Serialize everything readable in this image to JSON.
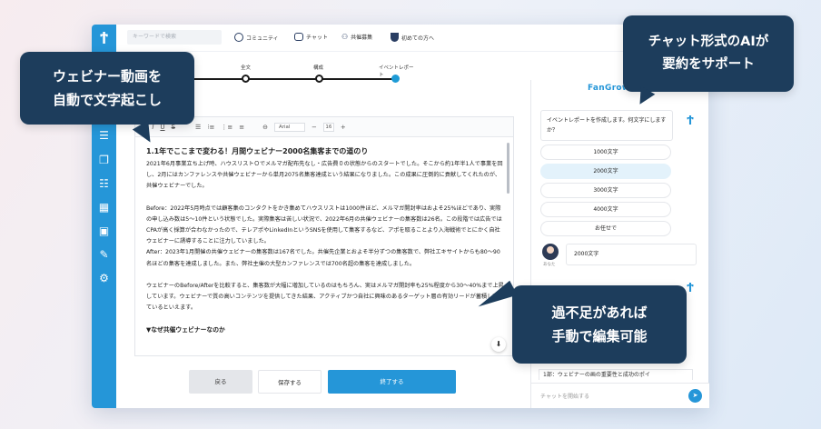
{
  "search": {
    "placeholder": "キーワードで検索"
  },
  "nav": {
    "items": [
      {
        "label": "コミュニティ",
        "icon": "globe-icon"
      },
      {
        "label": "チャット",
        "icon": "chat-bubble-icon"
      },
      {
        "label": "共催募集",
        "icon": "people-icon"
      },
      {
        "label": "初めての方へ",
        "icon": "shield-icon"
      }
    ]
  },
  "steps": {
    "items": [
      {
        "label": "全文",
        "active": false
      },
      {
        "label": "構成",
        "active": false
      },
      {
        "label": "イベントレポート",
        "active": true
      }
    ]
  },
  "toolbar": {
    "font": "Arial",
    "size": "16",
    "minus": "−",
    "plus": "+"
  },
  "editor": {
    "title": "1.1年でここまで変わる！月間ウェビナー2000名集客までの道のり",
    "paragraphs": [
      "2021年6月事業立ち上げ時、ハウスリストＯでメルマガ配布先なし・広告費０の状態からのスタートでした。そこから約1年半1人で事業を回し、2月にはカンファレンスや共催ウェビナーから単月2075名集客達成という結果になりました。この成果に圧倒的に貢献してくれたのが、共催ウェビナーでした。",
      "Before：2022年5月時点では顧客集のコンタクトをかき集めてハウスリストは1000件ほど、メルマガ開封率はおよそ25%ほどであり、実際の申し込み数は5〜10件という状態でした。実際集客は苦しい状況で、2022年6月の共催ウェビナーの集客数は26名。この段階では広告ではCPAが高く採算が合わなかったので、テレアポやLinkedInというSNSを使用して集客するなど、アポを取ることより入海戦術でとにかく自社ウェビナーに誘導することに注力していました。\nAfter：2023年1月開催の共催ウェビナーの集客数は167名でした。共催先企業とおよそ半分ずつの集客数で、弊社エキサイトからも80〜90名ほどの集客を達成しました。また、弊社主催の大型カンファレンスでは700名超の集客を達成しました。",
      "ウェビナーのBefore/Afterを比較すると、集客数が大幅に増加しているのはもちろん、実はメルマガ開封率も25%程度から30〜40%まで上昇しています。ウェビナーで質の高いコンテンツを提供してきた結果、アクティブかつ自社に興味のあるターゲット層の有効リードが蓄積してきているといえます。"
    ],
    "section_heading": "▼なぜ共催ウェビナーなのか"
  },
  "footer": {
    "back": "戻る",
    "save": "保存する",
    "finish": "終了する"
  },
  "chat": {
    "logo": "FanGrowth",
    "bot_message": "イベントレポートを作成します。何文字にしますか？",
    "options": [
      {
        "label": "1000文字",
        "selected": false
      },
      {
        "label": "2000文字",
        "selected": true
      },
      {
        "label": "3000文字",
        "selected": false
      },
      {
        "label": "4000文字",
        "selected": false
      },
      {
        "label": "お任せで",
        "selected": false
      }
    ],
    "user_reply": "2000文字",
    "user_name": "あなた",
    "preview": "1部：ウェビナーの画の重要性と成功のポイ",
    "input_placeholder": "チャットを開始する"
  },
  "callouts": {
    "left": [
      "ウェビナー動画を",
      "自動で文字起こし"
    ],
    "top_right": [
      "チャット形式のAIが",
      "要約をサポート"
    ],
    "bottom_right": [
      "過不足があれば",
      "手動で編集可能"
    ]
  },
  "colors": {
    "accent": "#2596d8",
    "callout": "#1d3d5c",
    "selected": "#e3f2fb"
  }
}
